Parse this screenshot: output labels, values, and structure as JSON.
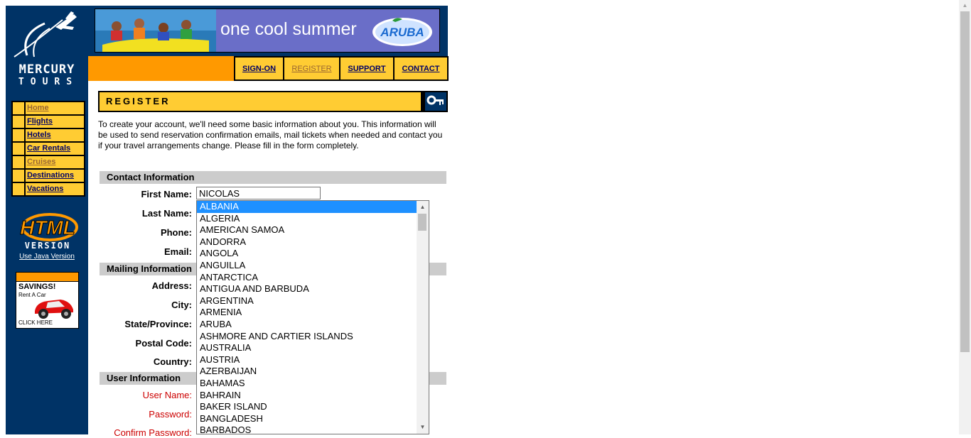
{
  "site": {
    "wordmark_line1": "MERCURY",
    "wordmark_line2": "TOURS"
  },
  "banner": {
    "tagline": "one cool summer",
    "brand": "ARUBA"
  },
  "top_nav": [
    {
      "label": "SIGN-ON",
      "visited": false
    },
    {
      "label": "REGISTER",
      "visited": true
    },
    {
      "label": "SUPPORT",
      "visited": false
    },
    {
      "label": "CONTACT",
      "visited": false
    }
  ],
  "side_nav": [
    {
      "label": "Home",
      "visited": true
    },
    {
      "label": "Flights",
      "visited": false
    },
    {
      "label": "Hotels",
      "visited": false
    },
    {
      "label": "Car Rentals",
      "visited": false
    },
    {
      "label": "Cruises",
      "visited": true
    },
    {
      "label": "Destinations",
      "visited": false
    },
    {
      "label": "Vacations",
      "visited": false
    }
  ],
  "html_version": {
    "line1": "HTML",
    "line2": "VERSION",
    "java_link": "Use Java Version"
  },
  "ad": {
    "headline": "SAVINGS!",
    "sub": "Rent A Car",
    "cta": "CLICK HERE"
  },
  "page": {
    "title": "REGISTER",
    "intro": "To create your account, we'll need some basic information about you. This information will be used to send reservation confirmation emails, mail tickets when needed and contact you if your travel arrangements change. Please fill in the form completely."
  },
  "sections": {
    "contact": "Contact Information",
    "mailing": "Mailing Information",
    "user": "User Information"
  },
  "labels": {
    "first_name": "First Name:",
    "last_name": "Last Name:",
    "phone": "Phone:",
    "email": "Email:",
    "address": "Address:",
    "city": "City:",
    "state": "State/Province:",
    "postal": "Postal Code:",
    "country": "Country:",
    "user_name": "User Name:",
    "password": "Password:",
    "confirm_password": "Confirm Password:"
  },
  "form": {
    "first_name_value": "NICOLAS"
  },
  "country_dropdown": {
    "selected": "ALBANIA",
    "options": [
      "ALBANIA",
      "ALGERIA",
      "AMERICAN SAMOA",
      "ANDORRA",
      "ANGOLA",
      "ANGUILLA",
      "ANTARCTICA",
      "ANTIGUA AND BARBUDA",
      "ARGENTINA",
      "ARMENIA",
      "ARUBA",
      "ASHMORE AND CARTIER ISLANDS",
      "AUSTRALIA",
      "AUSTRIA",
      "AZERBAIJAN",
      "BAHAMAS",
      "BAHRAIN",
      "BAKER ISLAND",
      "BANGLADESH",
      "BARBADOS"
    ]
  },
  "colors": {
    "navy": "#003366",
    "orange": "#ff9900",
    "yellow": "#ffcc33",
    "selection": "#1e90ff",
    "required_label": "#cc0000"
  }
}
